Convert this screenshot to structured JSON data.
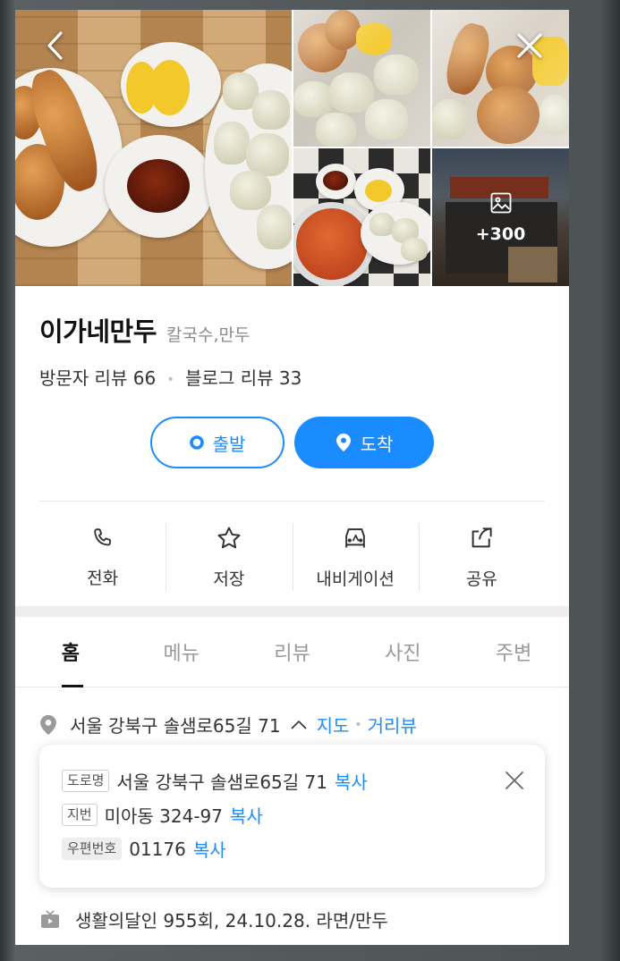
{
  "photos": {
    "more_count": "+300"
  },
  "place": {
    "name": "이가네만두",
    "category": "칼국수,만두"
  },
  "reviews": {
    "visitor": "방문자 리뷰 66",
    "blog": "블로그 리뷰 33"
  },
  "route": {
    "start_label": "출발",
    "arrive_label": "도착"
  },
  "actions": [
    {
      "label": "전화",
      "icon": "phone-icon"
    },
    {
      "label": "저장",
      "icon": "star-icon"
    },
    {
      "label": "내비게이션",
      "icon": "car-icon"
    },
    {
      "label": "공유",
      "icon": "share-icon"
    }
  ],
  "tabs": [
    "홈",
    "메뉴",
    "리뷰",
    "사진",
    "주변"
  ],
  "address": {
    "summary": "서울 강북구 솔샘로65길 71",
    "map_link": "지도",
    "street_link": "거리뷰",
    "road_tag": "도로명",
    "road": "서울 강북구 솔샘로65길 71",
    "lot_tag": "지번",
    "lot": "미아동 324-97",
    "zip_tag": "우편번호",
    "zip": "01176",
    "copy_label": "복사"
  },
  "tv": {
    "text": "생활의달인 955회, 24.10.28. 라면/만두"
  },
  "colors": {
    "accent": "#1a8cff"
  }
}
